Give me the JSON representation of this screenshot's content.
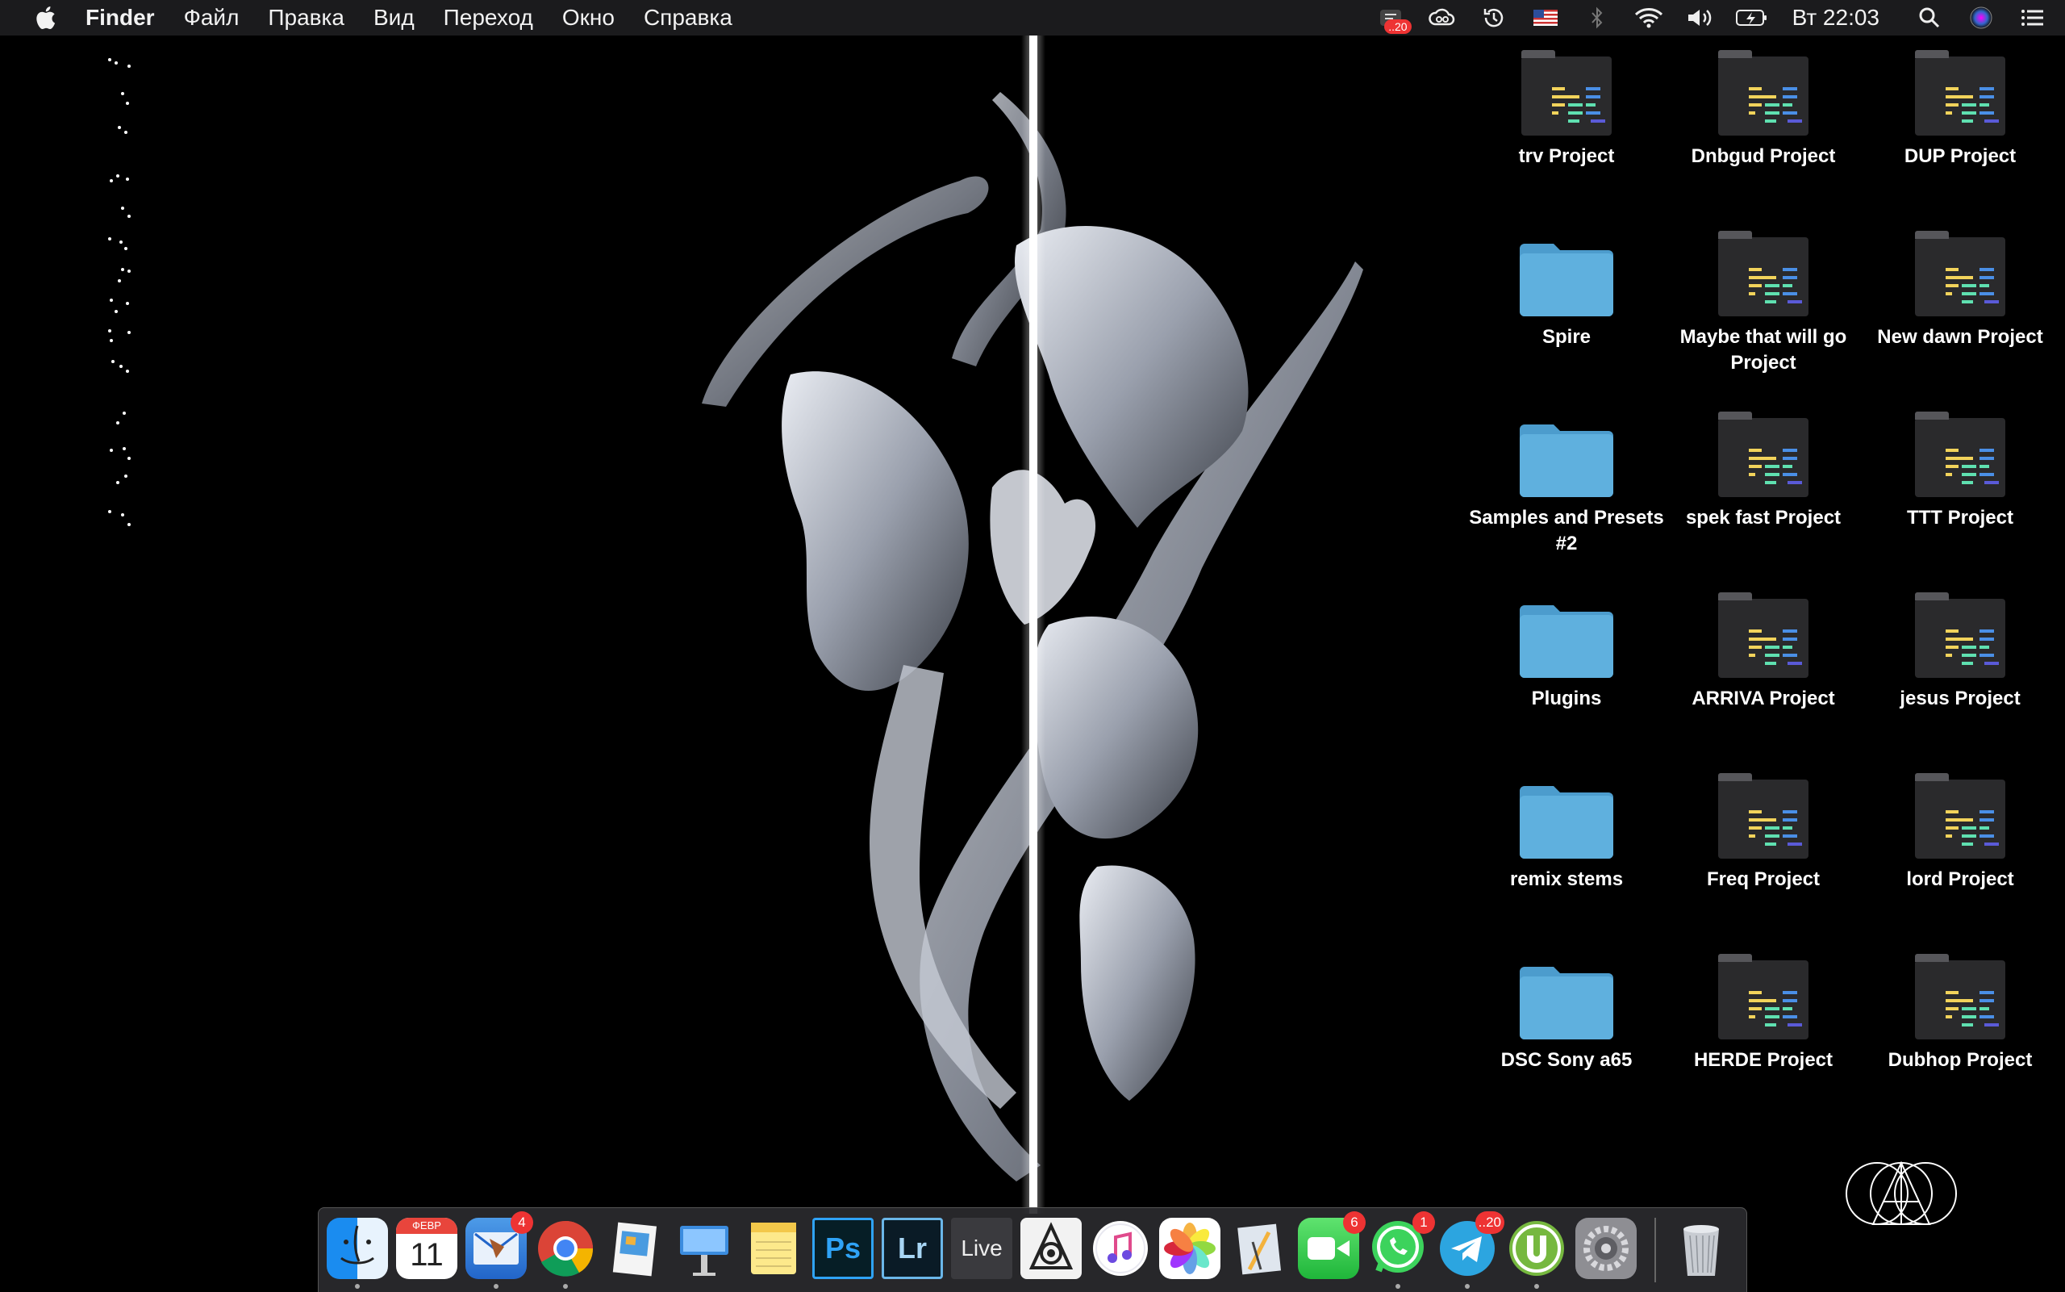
{
  "menubar": {
    "app_name": "Finder",
    "menus": [
      "Файл",
      "Правка",
      "Вид",
      "Переход",
      "Окно",
      "Справка"
    ],
    "status_icons": [
      {
        "name": "notification-icon",
        "badge": "20"
      },
      {
        "name": "creative-cloud-icon"
      },
      {
        "name": "time-machine-icon"
      },
      {
        "name": "us-flag-icon"
      },
      {
        "name": "bluetooth-icon"
      },
      {
        "name": "wifi-icon"
      },
      {
        "name": "volume-icon"
      },
      {
        "name": "battery-icon"
      }
    ],
    "clock": "Вт 22:03",
    "spotlight_icon": "search-icon",
    "siri_icon": "siri-icon",
    "notification_center_icon": "list-icon"
  },
  "desktop": {
    "items": [
      {
        "label": "trv Project",
        "kind": "ableton-project"
      },
      {
        "label": "Dnbgud Project",
        "kind": "ableton-project"
      },
      {
        "label": "DUP Project",
        "kind": "ableton-project"
      },
      {
        "label": "Spire",
        "kind": "folder"
      },
      {
        "label": "Maybe that will go Project",
        "kind": "ableton-project"
      },
      {
        "label": "New dawn Project",
        "kind": "ableton-project"
      },
      {
        "label": "Samples and Presets #2",
        "kind": "folder"
      },
      {
        "label": "spek fast Project",
        "kind": "ableton-project"
      },
      {
        "label": "TTT Project",
        "kind": "ableton-project"
      },
      {
        "label": "Plugins",
        "kind": "folder"
      },
      {
        "label": "ARRIVA Project",
        "kind": "ableton-project"
      },
      {
        "label": "jesus Project",
        "kind": "ableton-project"
      },
      {
        "label": "remix stems",
        "kind": "folder"
      },
      {
        "label": "Freq Project",
        "kind": "ableton-project"
      },
      {
        "label": "lord Project",
        "kind": "ableton-project"
      },
      {
        "label": "DSC Sony a65",
        "kind": "folder"
      },
      {
        "label": "HERDE Project",
        "kind": "ableton-project"
      },
      {
        "label": "Dubhop Project",
        "kind": "ableton-project"
      }
    ]
  },
  "dock": {
    "items": [
      {
        "name": "finder",
        "icon": "finder-icon",
        "running": true
      },
      {
        "name": "calendar",
        "icon": "calendar-icon",
        "month": "ФЕВР",
        "day": "11"
      },
      {
        "name": "mail",
        "icon": "mail-icon",
        "badge": "4",
        "running": true
      },
      {
        "name": "chrome",
        "icon": "chrome-icon",
        "running": true
      },
      {
        "name": "preview",
        "icon": "preview-icon"
      },
      {
        "name": "keynote",
        "icon": "keynote-icon"
      },
      {
        "name": "notes",
        "icon": "notes-icon"
      },
      {
        "name": "photoshop",
        "icon": "photoshop-icon",
        "text": "Ps"
      },
      {
        "name": "lightroom",
        "icon": "lightroom-icon",
        "text": "Lr"
      },
      {
        "name": "ableton-live",
        "icon": "live-icon",
        "text": "Live"
      },
      {
        "name": "steam",
        "icon": "steam-icon"
      },
      {
        "name": "music",
        "icon": "music-icon"
      },
      {
        "name": "photos",
        "icon": "photos-icon"
      },
      {
        "name": "app-store-alt",
        "icon": "instruments-icon"
      },
      {
        "name": "facetime",
        "icon": "facetime-icon",
        "badge": "6"
      },
      {
        "name": "whatsapp",
        "icon": "whatsapp-icon",
        "badge": "1",
        "running": true
      },
      {
        "name": "telegram",
        "icon": "telegram-icon",
        "badge": "20",
        "running": true
      },
      {
        "name": "utorrent",
        "icon": "utorrent-icon",
        "running": true
      },
      {
        "name": "system-preferences",
        "icon": "gear-icon"
      },
      {
        "name": "trash",
        "icon": "trash-icon"
      }
    ]
  },
  "colors": {
    "menubar_bg": "#1b1b1d",
    "folder_blue": "#5fb0de",
    "ableton_yellow": "#f2d35b",
    "ableton_green": "#5fe0b0",
    "ableton_blue": "#4a8fe6",
    "badge_red": "#e33333"
  }
}
